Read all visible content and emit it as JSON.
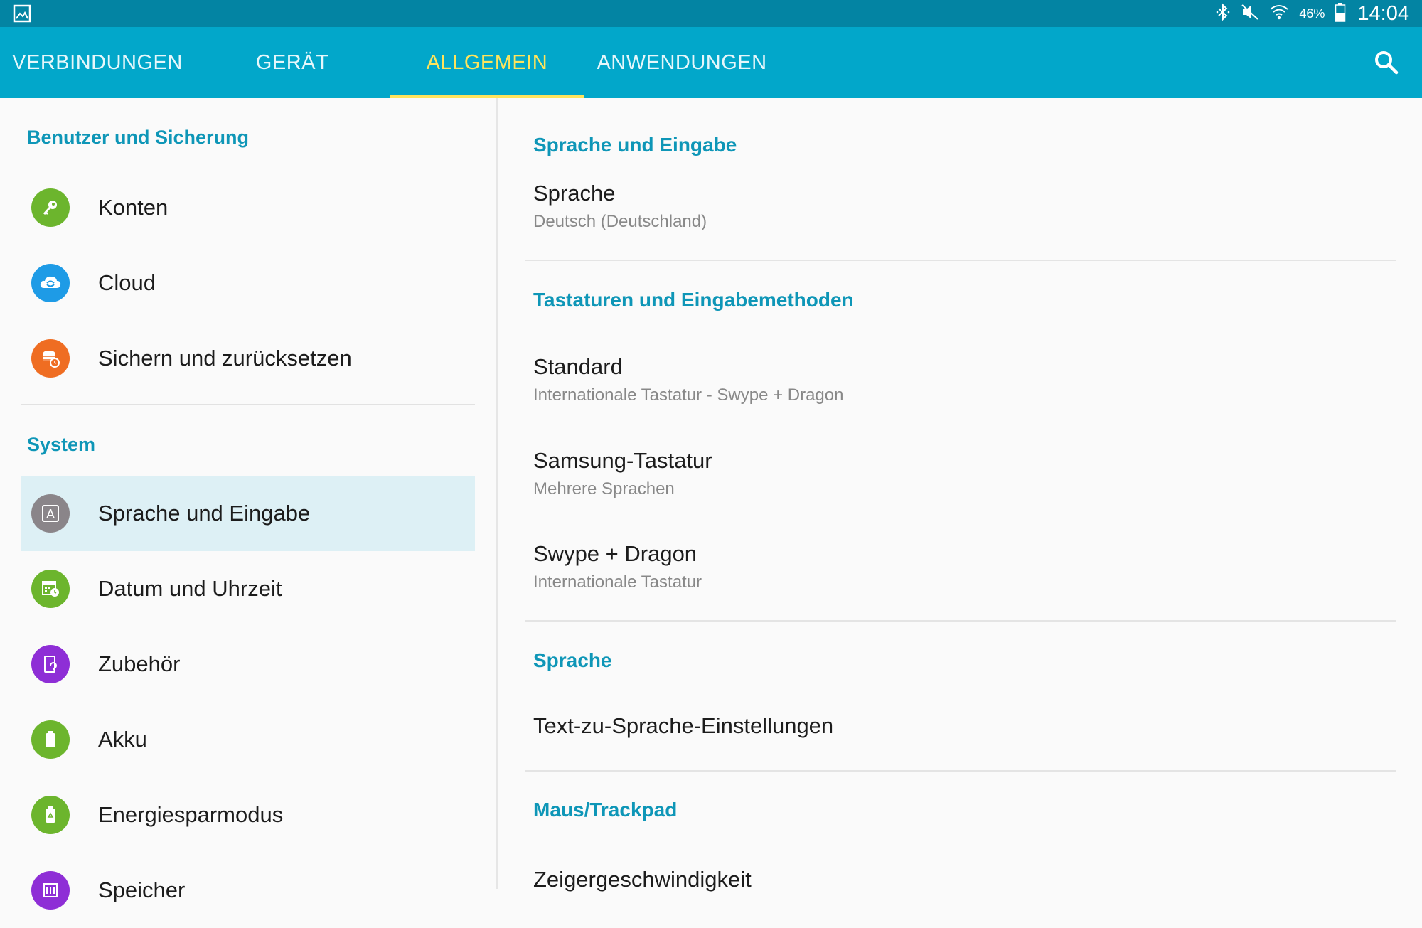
{
  "status_bar": {
    "battery_percent": "46%",
    "time": "14:04",
    "icons": [
      "gallery-icon",
      "bluetooth-icon",
      "mute-icon",
      "wifi-icon",
      "battery-icon"
    ]
  },
  "tabs": [
    {
      "label": "VERBINDUNGEN",
      "active": false
    },
    {
      "label": "GERÄT",
      "active": false
    },
    {
      "label": "ALLGEMEIN",
      "active": true
    },
    {
      "label": "ANWENDUNGEN",
      "active": false
    }
  ],
  "colors": {
    "status_bar": "#0384a3",
    "tab_bar": "#02a7ca",
    "active_tab": "#ffe45c",
    "section_header": "#0e96b7",
    "selected_row": "#ddf0f5"
  },
  "sidebar": {
    "sections": [
      {
        "header": "Benutzer und Sicherung",
        "items": [
          {
            "label": "Konten",
            "icon": "key-icon",
            "color": "#6cb52d"
          },
          {
            "label": "Cloud",
            "icon": "cloud-sync-icon",
            "color": "#1e9be6"
          },
          {
            "label": "Sichern und zurücksetzen",
            "icon": "backup-icon",
            "color": "#ef6d22"
          }
        ]
      },
      {
        "header": "System",
        "items": [
          {
            "label": "Sprache und Eingabe",
            "icon": "language-icon",
            "color": "#8a8589",
            "selected": true
          },
          {
            "label": "Datum und Uhrzeit",
            "icon": "calendar-clock-icon",
            "color": "#6cb52d"
          },
          {
            "label": "Zubehör",
            "icon": "accessory-icon",
            "color": "#8e2ed6"
          },
          {
            "label": "Akku",
            "icon": "battery-icon",
            "color": "#6cb52d"
          },
          {
            "label": "Energiesparmodus",
            "icon": "power-saving-icon",
            "color": "#6cb52d"
          },
          {
            "label": "Speicher",
            "icon": "storage-icon",
            "color": "#8e2ed6"
          }
        ]
      }
    ]
  },
  "detail": {
    "sections": [
      {
        "header": "Sprache und Eingabe",
        "items": [
          {
            "title": "Sprache",
            "subtitle": "Deutsch (Deutschland)"
          }
        ]
      },
      {
        "header": "Tastaturen und Eingabemethoden",
        "items": [
          {
            "title": "Standard",
            "subtitle": "Internationale Tastatur - Swype + Dragon"
          },
          {
            "title": "Samsung-Tastatur",
            "subtitle": "Mehrere Sprachen"
          },
          {
            "title": "Swype + Dragon",
            "subtitle": "Internationale Tastatur"
          }
        ]
      },
      {
        "header": "Sprache",
        "items": [
          {
            "title": "Text-zu-Sprache-Einstellungen",
            "subtitle": ""
          }
        ]
      },
      {
        "header": "Maus/Trackpad",
        "items": [
          {
            "title": "Zeigergeschwindigkeit",
            "subtitle": ""
          }
        ]
      }
    ]
  }
}
